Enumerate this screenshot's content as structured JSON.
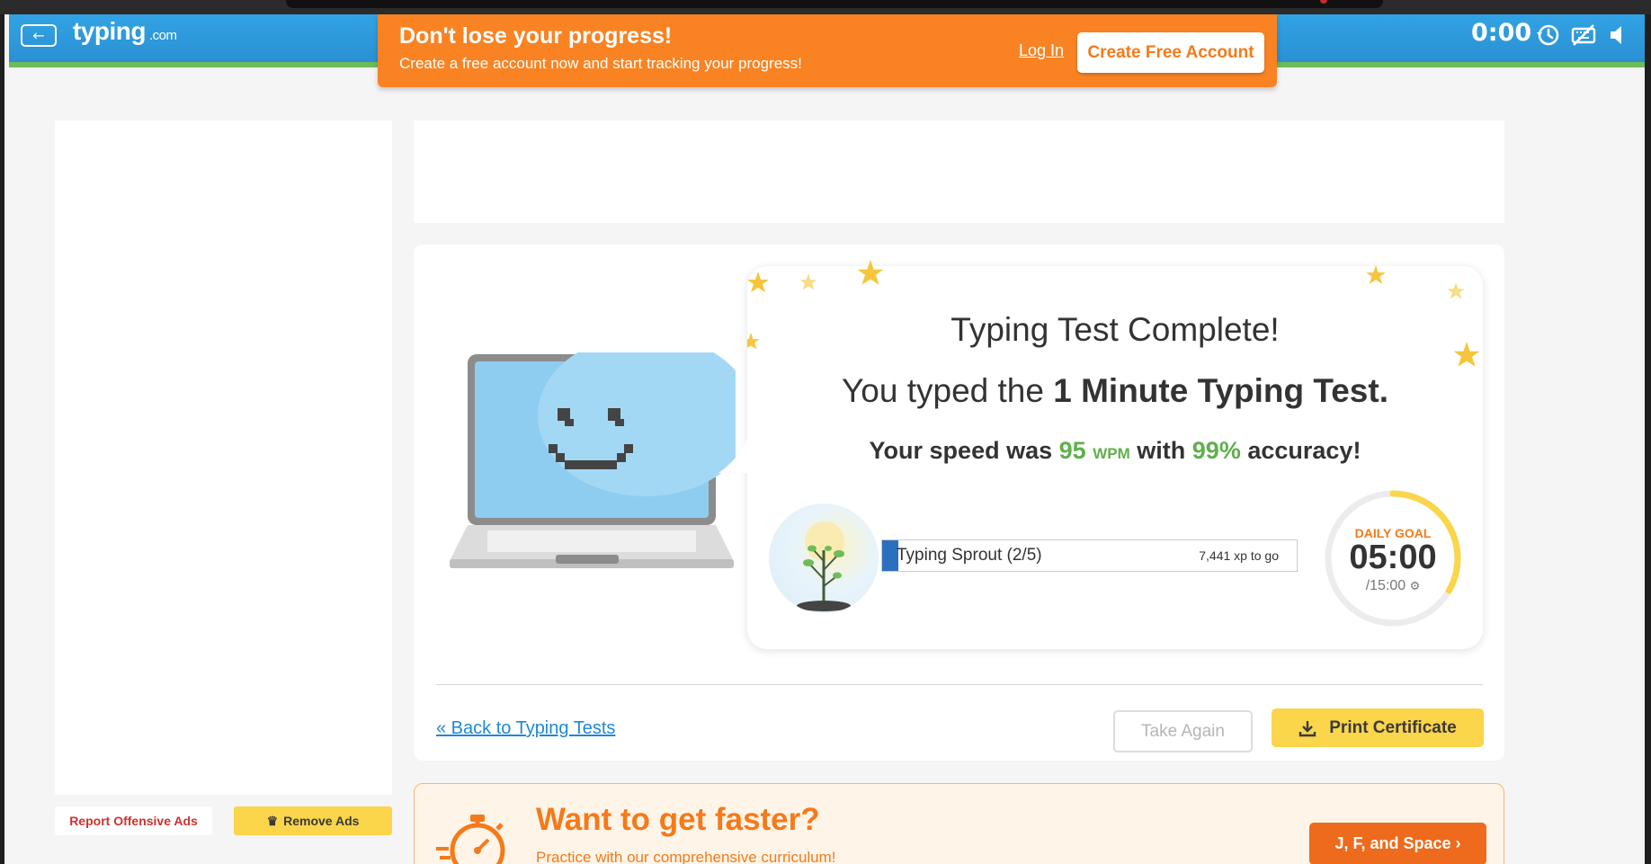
{
  "header": {
    "back_icon": "arrow-left-icon",
    "logo_main": "typing",
    "logo_suffix": ".com",
    "timer": "0:00",
    "icons": [
      "history-icon",
      "keyboard-off-icon",
      "sound-icon"
    ]
  },
  "banner": {
    "title": "Don't lose your progress!",
    "subtitle": "Create a free account now and start tracking your progress!",
    "login_label": "Log In",
    "create_label": "Create Free Account"
  },
  "sidebar": {
    "report_ads_label": "Report Offensive Ads",
    "remove_ads_label": "Remove Ads",
    "remove_ads_icon": "crown-icon"
  },
  "results": {
    "title": "Typing Test Complete!",
    "typed_prefix": "You typed the",
    "test_name": "1 Minute Typing Test.",
    "speed_prefix": "Your speed was",
    "wpm": "95",
    "wpm_unit": "WPM",
    "speed_middle": "with",
    "accuracy": "99%",
    "speed_suffix": "accuracy!",
    "level_label": "Typing Sprout (2/5)",
    "xp_to_go": "7,441 xp to go",
    "xp_progress": 0.04,
    "daily_goal_label": "DAILY GOAL",
    "daily_goal_value": "05:00",
    "daily_goal_total": "/15:00",
    "daily_goal_progress": 0.333,
    "back_link": "« Back to Typing Tests",
    "take_again_label": "Take Again",
    "print_label": "Print Certificate",
    "print_icon": "download-icon"
  },
  "promo": {
    "title": "Want to get faster?",
    "subtitle": "Practice with our comprehensive curriculum!",
    "button_label": "J, F, and Space ›",
    "icon": "stopwatch-icon"
  },
  "colors": {
    "header_blue": "#2a90d3",
    "banner_orange": "#f98323",
    "accent_green": "#5fb04c",
    "goal_yellow": "#fbd54a",
    "promo_orange": "#ee6a1d",
    "link_blue": "#1e88d8"
  }
}
